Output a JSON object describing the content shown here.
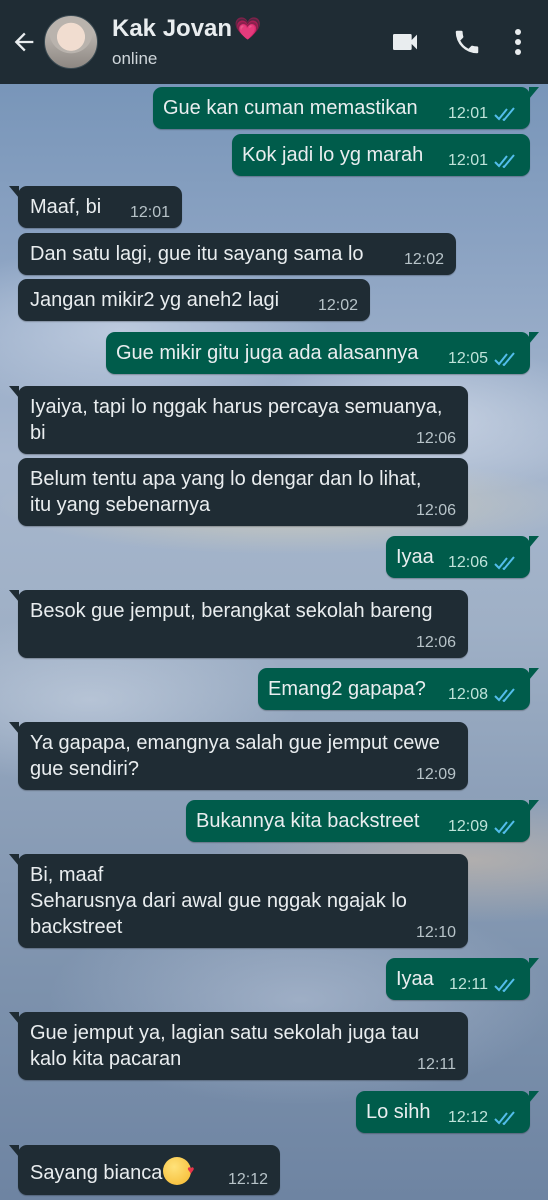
{
  "header": {
    "contact_name": "Kak Jovan",
    "status": "online",
    "colors": {
      "bar": "#1f2c34",
      "incoming": "#1f2c34",
      "outgoing": "#005c4b",
      "read_tick": "#53bdeb"
    }
  },
  "messages": [
    {
      "dir": "out",
      "text": "Gue kan cuman memastikan",
      "time": "12:01"
    },
    {
      "dir": "out",
      "text": "Kok jadi lo yg marah",
      "time": "12:01"
    },
    {
      "dir": "in",
      "text": "Maaf, bi",
      "time": "12:01"
    },
    {
      "dir": "in",
      "text": "Dan satu lagi, gue itu sayang sama lo",
      "time": "12:02"
    },
    {
      "dir": "in",
      "text": "Jangan mikir2 yg aneh2 lagi",
      "time": "12:02"
    },
    {
      "dir": "out",
      "text": "Gue mikir gitu juga ada alasannya",
      "time": "12:05"
    },
    {
      "dir": "in",
      "text": "Iyaiya, tapi lo nggak harus percaya semuanya,\nbi",
      "time": "12:06"
    },
    {
      "dir": "in",
      "text": "Belum tentu apa yang lo dengar dan lo lihat,\nitu yang sebenarnya",
      "time": "12:06"
    },
    {
      "dir": "out",
      "text": "Iyaa",
      "time": "12:06"
    },
    {
      "dir": "in",
      "text": "Besok gue jemput, berangkat sekolah bareng",
      "time": "12:06"
    },
    {
      "dir": "out",
      "text": "Emang2 gapapa?",
      "time": "12:08"
    },
    {
      "dir": "in",
      "text": "Ya gapapa, emangnya salah gue jemput cewe\ngue sendiri?",
      "time": "12:09"
    },
    {
      "dir": "out",
      "text": "Bukannya kita backstreet",
      "time": "12:09"
    },
    {
      "dir": "in",
      "text": "Bi, maaf\nSeharusnya dari awal gue nggak ngajak lo\nbackstreet",
      "time": "12:10"
    },
    {
      "dir": "out",
      "text": "Iyaa",
      "time": "12:11"
    },
    {
      "dir": "in",
      "text": "Gue jemput ya, lagian satu sekolah juga tau\nkalo kita pacaran",
      "time": "12:11"
    },
    {
      "dir": "out",
      "text": "Lo sihh",
      "time": "12:12"
    },
    {
      "dir": "in",
      "text": "Sayang bianca",
      "time": "12:12"
    }
  ]
}
